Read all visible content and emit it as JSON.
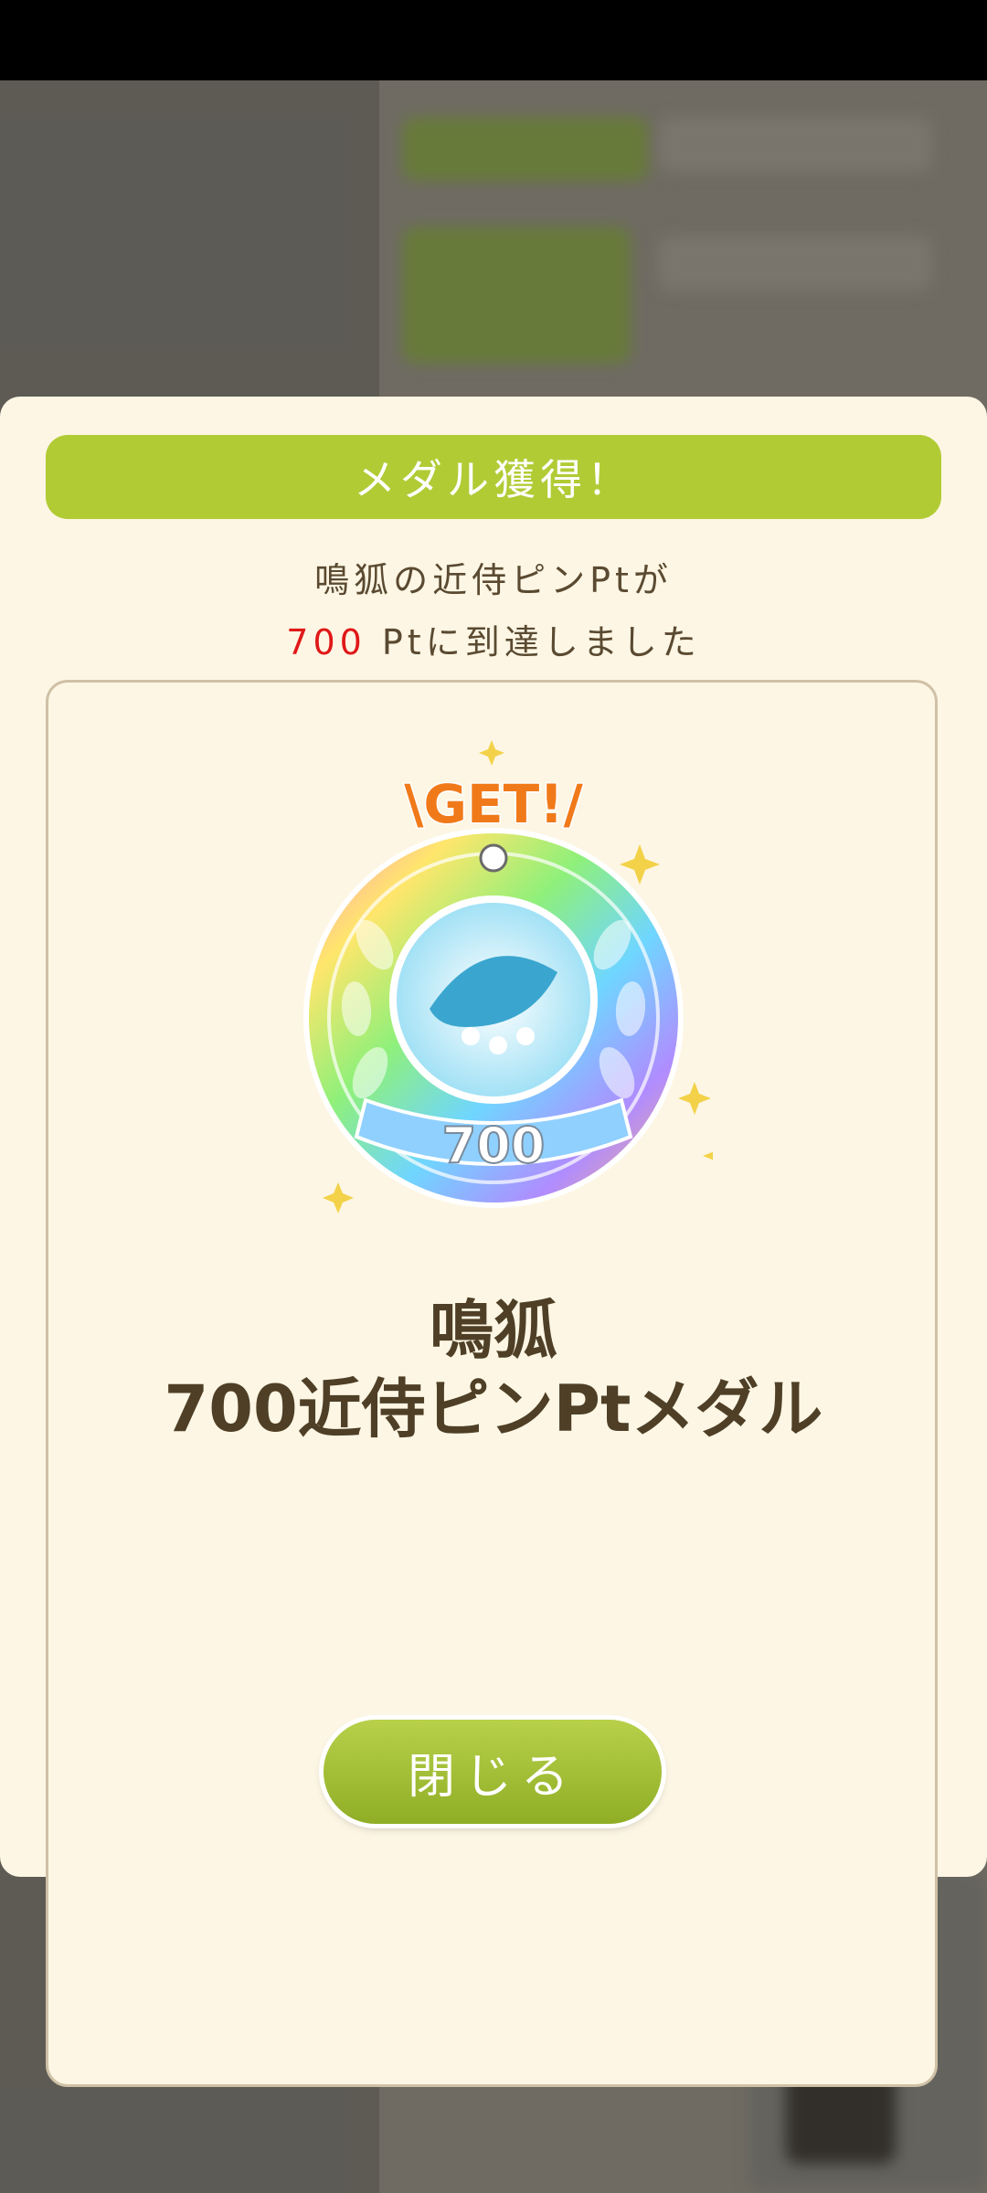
{
  "modal": {
    "header_title": "メダル獲得！",
    "message_line1": "鳴狐の近侍ピンPtが",
    "message_points": "700",
    "message_line2_rest": " Ptに到達しました",
    "medal": {
      "badge_text": "\\GET!/",
      "medal_number": "700",
      "name_line1": "鳴狐",
      "name_line2": "700近侍ピンPtメダル"
    },
    "close_label": "閉じる"
  },
  "colors": {
    "header_green": "#b1cb35",
    "button_green": "#9dbb2f",
    "points_red": "#e01818",
    "modal_bg": "#fdf6e4",
    "text_brown": "#5a4a31"
  }
}
